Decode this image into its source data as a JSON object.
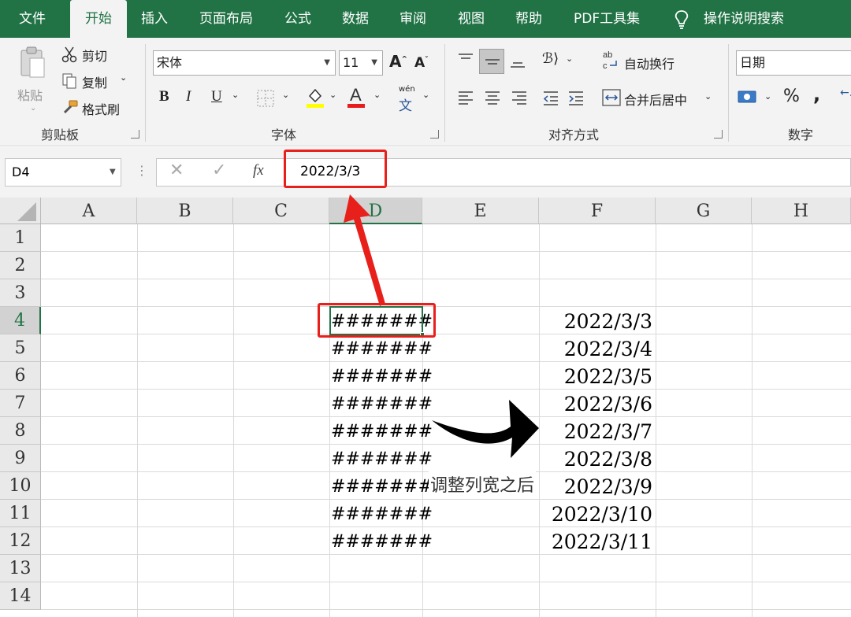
{
  "menu": {
    "tabs": [
      "文件",
      "开始",
      "插入",
      "页面布局",
      "公式",
      "数据",
      "审阅",
      "视图",
      "帮助",
      "PDF工具集"
    ],
    "active_tab": "开始",
    "search_label": "操作说明搜索"
  },
  "ribbon": {
    "clipboard": {
      "paste": "粘贴",
      "cut": "剪切",
      "copy": "复制",
      "format_painter": "格式刷",
      "group_label": "剪贴板"
    },
    "font": {
      "font_name": "宋体",
      "font_size": "11",
      "bold": "B",
      "italic": "I",
      "underline": "U",
      "phonetic": "wén",
      "phonetic_char": "文",
      "group_label": "字体"
    },
    "alignment": {
      "wrap_text": "自动换行",
      "merge_center": "合并后居中",
      "group_label": "对齐方式"
    },
    "number": {
      "format": "日期",
      "percent": "%",
      "comma": ",",
      "group_label": "数字"
    }
  },
  "formula_bar": {
    "name_box": "D4",
    "fx": "fx",
    "value": "2022/3/3"
  },
  "sheet": {
    "columns": [
      "A",
      "B",
      "C",
      "D",
      "E",
      "F",
      "G",
      "H"
    ],
    "rows": [
      "1",
      "2",
      "3",
      "4",
      "5",
      "6",
      "7",
      "8",
      "9",
      "10",
      "11",
      "12",
      "13",
      "14"
    ],
    "active_cell": "D4",
    "column_d_display": [
      "#######",
      "#######",
      "#######",
      "#######",
      "#######",
      "#######",
      "#######",
      "#######",
      "#######"
    ],
    "column_f_values": [
      "2022/3/3",
      "2022/3/4",
      "2022/3/5",
      "2022/3/6",
      "2022/3/7",
      "2022/3/8",
      "2022/3/9",
      "2022/3/10",
      "2022/3/11"
    ]
  },
  "annotation": {
    "text": "调整列宽之后",
    "highlight_color": "#e8201c"
  },
  "colors": {
    "accent": "#217346",
    "ribbon_bg": "#f3f3f3",
    "annotation_red": "#e8201c"
  }
}
